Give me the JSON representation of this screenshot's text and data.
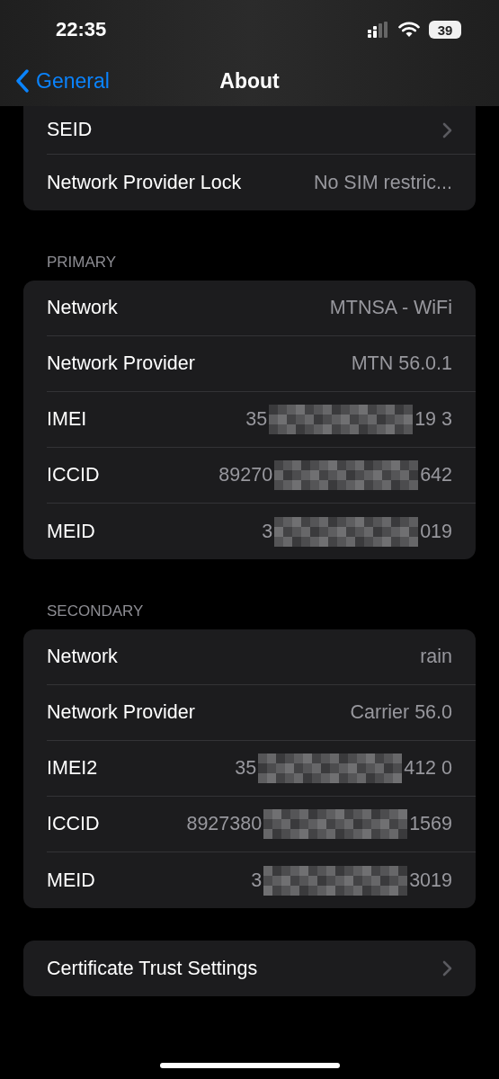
{
  "status_bar": {
    "time": "22:35",
    "battery": "39"
  },
  "nav": {
    "back": "General",
    "title": "About"
  },
  "sections": [
    {
      "rows": [
        {
          "kind": "disclosure",
          "label": "SEID"
        },
        {
          "kind": "value",
          "label": "Network Provider Lock",
          "value": "No SIM restric..."
        }
      ]
    },
    {
      "header": "PRIMARY",
      "rows": [
        {
          "kind": "value",
          "label": "Network",
          "value": "MTNSA - WiFi"
        },
        {
          "kind": "value",
          "label": "Network Provider",
          "value": "MTN 56.0.1"
        },
        {
          "kind": "redacted",
          "label": "IMEI",
          "value_start": "35",
          "value_end": "19 3"
        },
        {
          "kind": "redacted",
          "label": "ICCID",
          "value_start": "89270",
          "value_end": "642"
        },
        {
          "kind": "redacted",
          "label": "MEID",
          "value_start": "3",
          "value_end": "019"
        }
      ]
    },
    {
      "header": "SECONDARY",
      "rows": [
        {
          "kind": "value",
          "label": "Network",
          "value": "rain"
        },
        {
          "kind": "value",
          "label": "Network Provider",
          "value": "Carrier 56.0"
        },
        {
          "kind": "redacted",
          "label": "IMEI2",
          "value_start": "35",
          "value_end": "412 0"
        },
        {
          "kind": "redacted",
          "label": "ICCID",
          "value_start": "8927380",
          "value_end": "1569"
        },
        {
          "kind": "redacted",
          "label": "MEID",
          "value_start": "3",
          "value_end": "3019"
        }
      ]
    },
    {
      "rows": [
        {
          "kind": "disclosure",
          "label": "Certificate Trust Settings"
        }
      ]
    }
  ]
}
